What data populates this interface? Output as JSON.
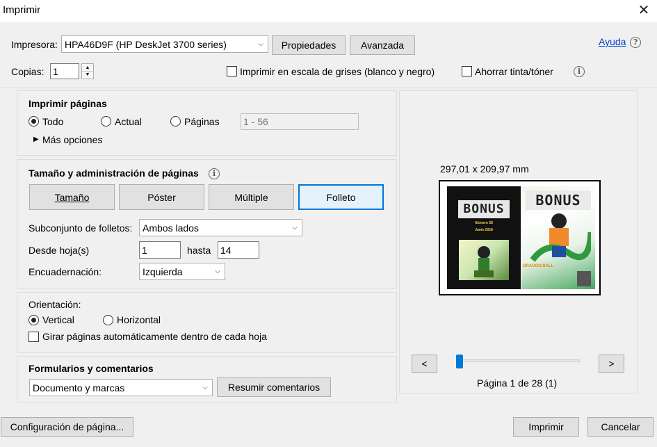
{
  "window": {
    "title": "Imprimir"
  },
  "printer": {
    "label": "Impresora:",
    "selected": "HPA46D9F (HP DeskJet 3700 series)",
    "properties_label": "Propiedades",
    "advanced_label": "Avanzada",
    "help_label": "Ayuda"
  },
  "copies": {
    "label": "Copias:",
    "value": "1"
  },
  "options": {
    "grayscale_label": "Imprimir en escala de grises (blanco y negro)",
    "save_ink_label": "Ahorrar tinta/tóner"
  },
  "print_pages": {
    "title": "Imprimir páginas",
    "all_label": "Todo",
    "current_label": "Actual",
    "pages_label": "Páginas",
    "pages_value": "1 - 56",
    "more_options_label": "Más opciones"
  },
  "page_sizing": {
    "title": "Tamaño y administración de páginas",
    "tabs": [
      "Tamaño",
      "Póster",
      "Múltiple",
      "Folleto"
    ],
    "subset_label": "Subconjunto de folletos:",
    "subset_value": "Ambos lados",
    "from_label": "Desde hoja(s)",
    "from_value": "1",
    "to_label": "hasta",
    "to_value": "14",
    "binding_label": "Encuadernación:",
    "binding_value": "Izquierda"
  },
  "orientation": {
    "label": "Orientación:",
    "portrait_label": "Vertical",
    "landscape_label": "Horizontal",
    "auto_rotate_label": "Girar páginas automáticamente dentro de cada hoja"
  },
  "forms": {
    "title": "Formularios y comentarios",
    "selected": "Documento y marcas",
    "summarize_label": "Resumir comentarios"
  },
  "preview": {
    "dimensions": "297,01 x 209,97 mm",
    "prev_label": "<",
    "next_label": ">",
    "page_indicator": "Página 1 de 28 (1)",
    "slider_position": 0.0,
    "left_page": {
      "title": "BONUS",
      "subtitle": "Número 28",
      "date": "Junio 2018"
    },
    "right_page": {
      "title": "BONUS",
      "caption": "DRAGON BALL"
    }
  },
  "footer": {
    "page_setup_label": "Configuración de página...",
    "print_label": "Imprimir",
    "cancel_label": "Cancelar"
  }
}
